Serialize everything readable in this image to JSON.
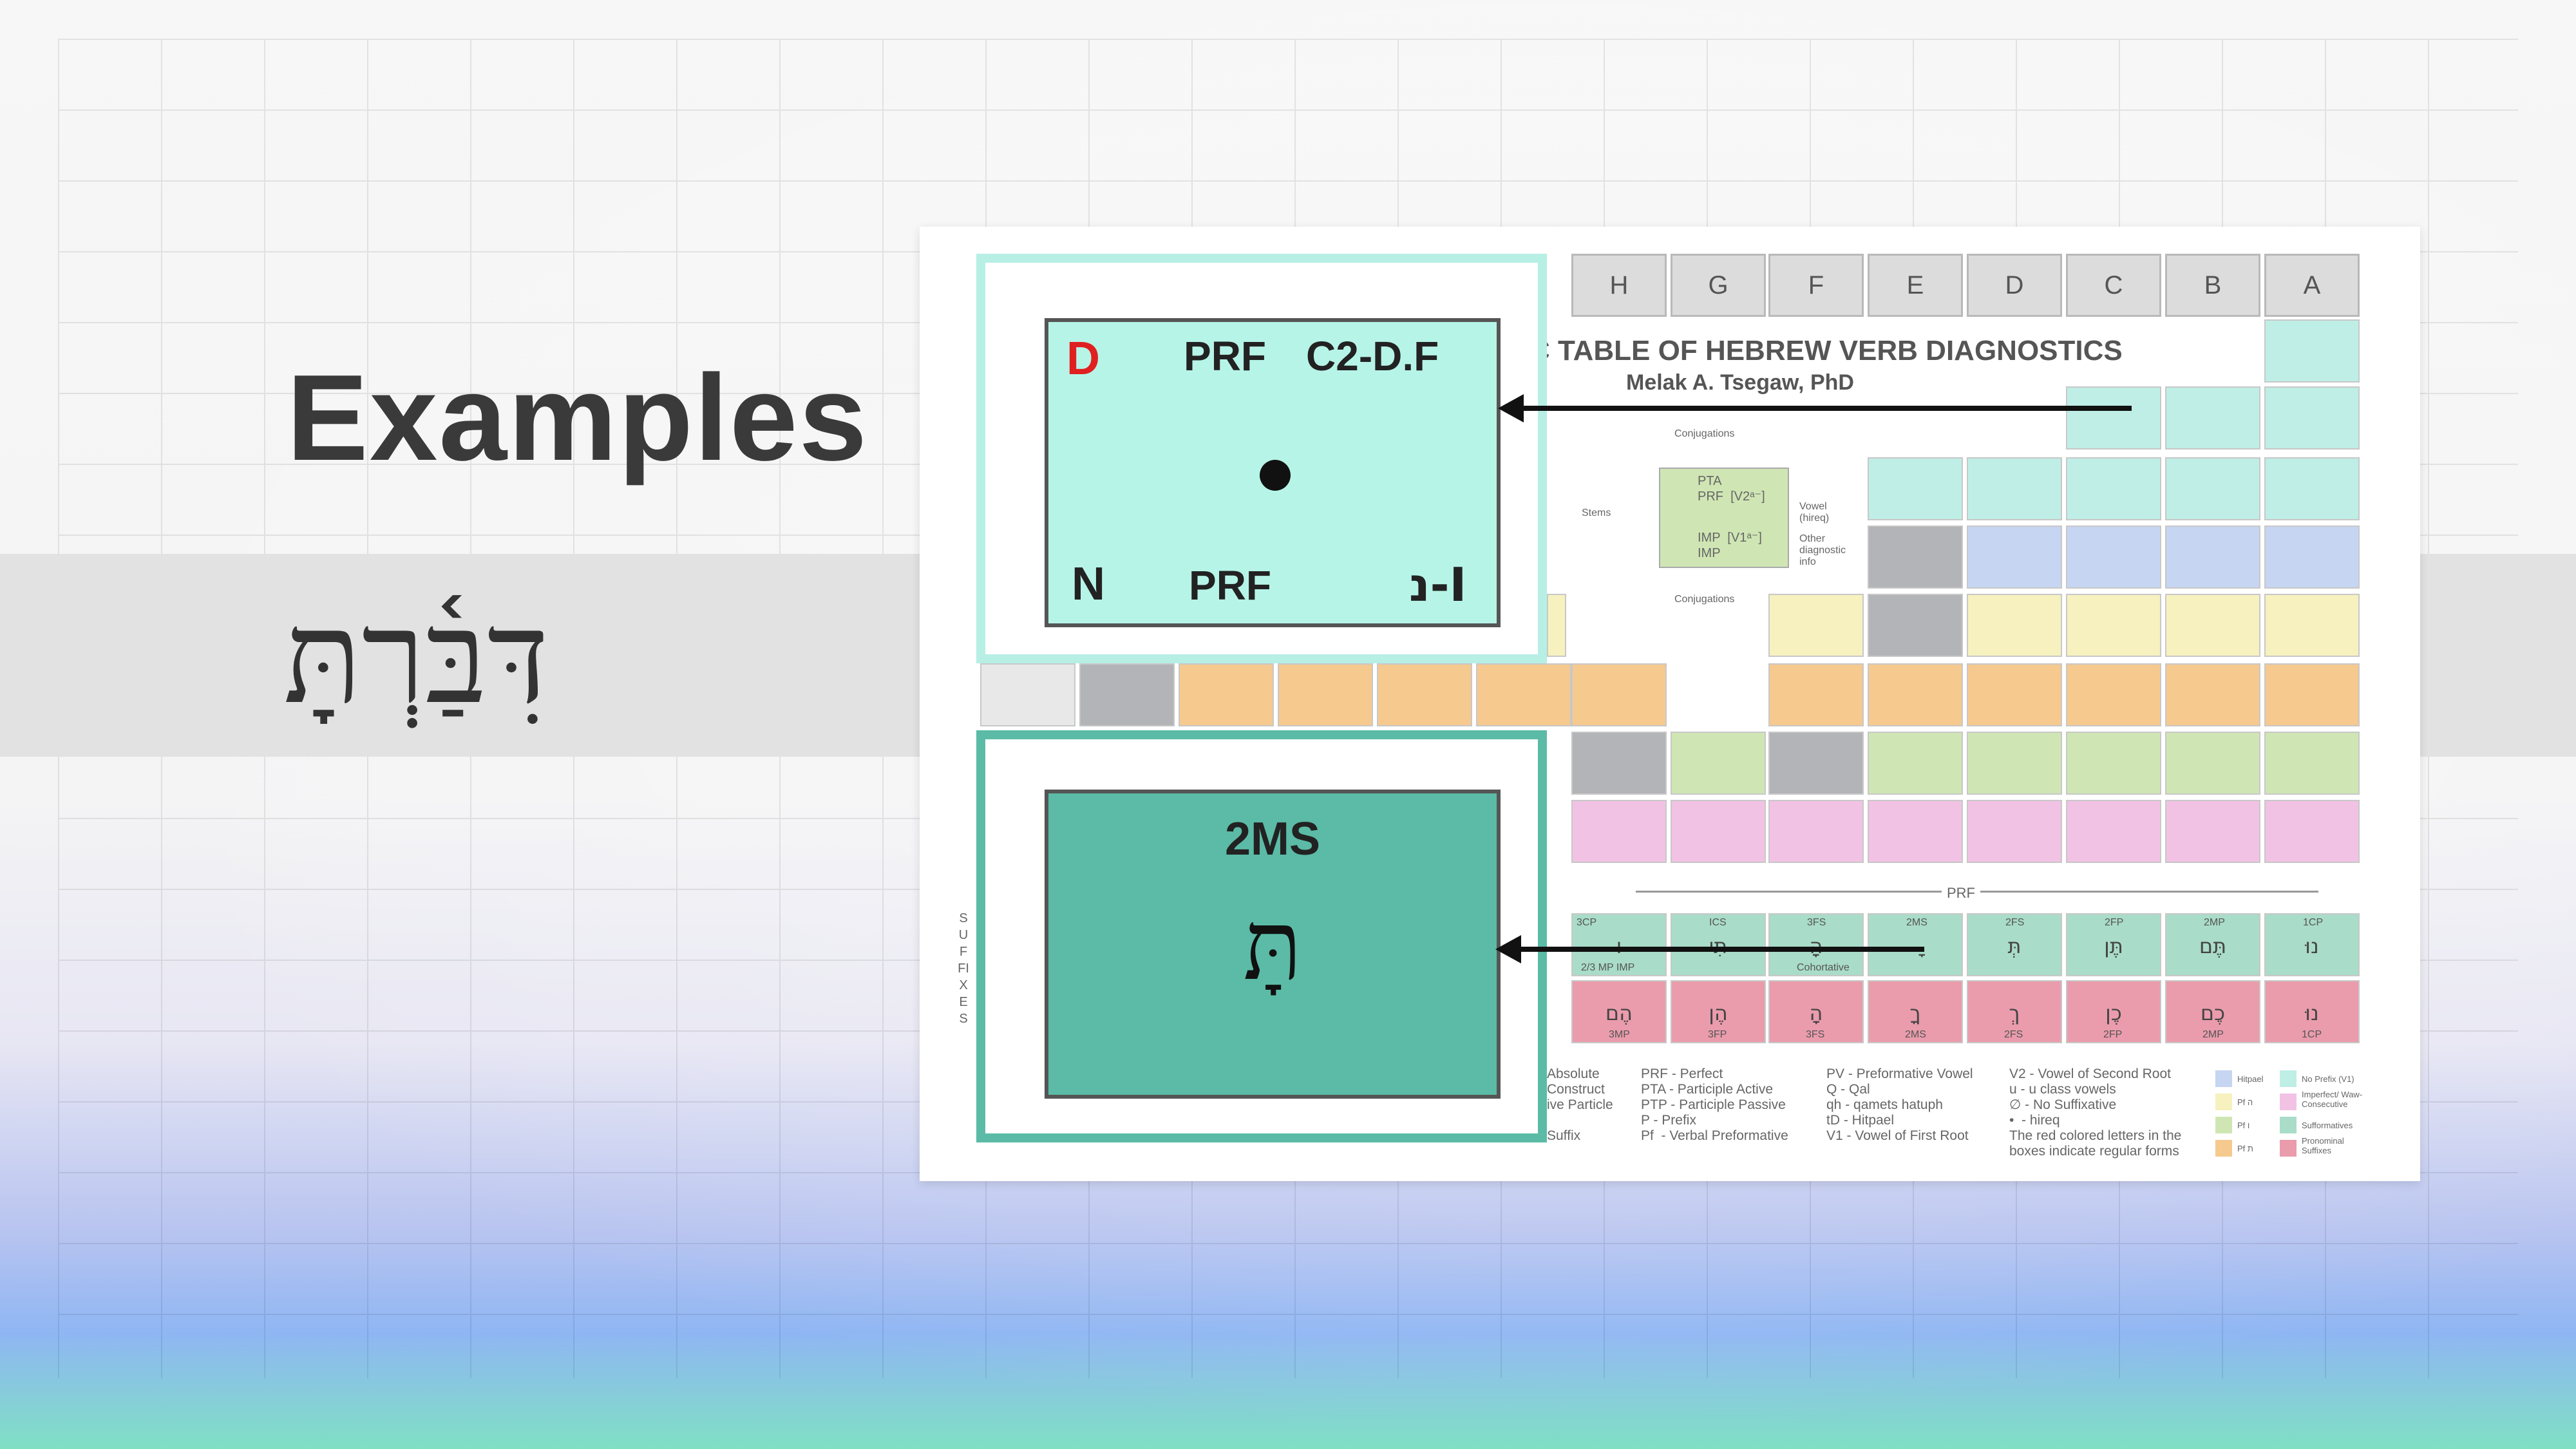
{
  "slide": {
    "title": "Examples",
    "hebrew_word": "דִּבַּ֫רְתָּ"
  },
  "poster": {
    "column_headers": [
      "H",
      "G",
      "F",
      "E",
      "D",
      "C",
      "B",
      "A"
    ],
    "title": "C TABLE OF HEBREW VERB DIAGNOSTICS",
    "author": "Melak A. Tsegaw, PhD",
    "diagram": {
      "top_label": "Conjugations",
      "bottom_label": "Conjugations",
      "stems_label": "Stems",
      "vowel_label": "Vowel\n(hireq)",
      "other_label": "Other\ndiagnostic\ninfo",
      "line1": "PTA",
      "line2": "PRF  [V2ᵃ⁻]",
      "line3": "IMP  [V1ᵃ⁻]",
      "line4": "IMP"
    },
    "prf_bar_label": "PRF",
    "suffixes_vertical": "SUFFIXES",
    "suffix_row_top": [
      {
        "code": "3CP",
        "glyph": "ּו"
      },
      {
        "code": "ICS",
        "glyph": "תִּי"
      },
      {
        "code": "3FS",
        "glyph": "ָה"
      },
      {
        "code": "2MS",
        "glyph": "ָּ"
      },
      {
        "code": "2FS",
        "glyph": "תְּ"
      },
      {
        "code": "2FP",
        "glyph": "תֶּן"
      },
      {
        "code": "2MP",
        "glyph": "תֶּם"
      },
      {
        "code": "1CP",
        "glyph": "נוּ"
      }
    ],
    "suffix_row_bottom": [
      {
        "code": "3MP",
        "glyph": "הֶם"
      },
      {
        "code": "3FP",
        "glyph": "הֶן"
      },
      {
        "code": "3FS",
        "glyph": "הָ"
      },
      {
        "code": "2MS",
        "glyph": "ךָ"
      },
      {
        "code": "2FS",
        "glyph": "ךְ"
      },
      {
        "code": "2FP",
        "glyph": "כֶן"
      },
      {
        "code": "2MP",
        "glyph": "כֶם"
      },
      {
        "code": "1CP",
        "glyph": "נוּ"
      }
    ],
    "cohortative_label": "Cohortative",
    "imp_label": "2/3 MP IMP",
    "legend_col1": "Absolute\nConstruct\nive Particle\n\nSuffix",
    "legend_col2": "PRF - Perfect\nPTA - Participle Active\nPTP - Participle Passive\nP - Prefix\nPf  - Verbal Preformative",
    "legend_col3": "PV - Preformative Vowel\nQ - Qal\nqh - qamets hatuph\ntD - Hitpael\nV1 - Vowel of First Root",
    "legend_col4": "V2 - Vowel of Second Root\nu - u class vowels\n∅ - No Suffixative\n•  - hireq\nThe red colored letters in the\nboxes indicate regular forms",
    "legend_swatches": [
      {
        "label": "Hitpael",
        "color": "#c5d5f2"
      },
      {
        "label": "Pf ה",
        "color": "#f6f1bf"
      },
      {
        "label": "Pf ו",
        "color": "#cfe6b4"
      },
      {
        "label": "Pf ת",
        "color": "#f6c98f"
      },
      {
        "label": "No Prefix (V1)",
        "color": "#bfeee6"
      },
      {
        "label": "Imperfect/ Waw-Consecutive",
        "color": "#f1c2e4"
      },
      {
        "label": "Sufformatives",
        "color": "#a9dcc9"
      },
      {
        "label": "Pronominal Suffixes",
        "color": "#ea9cac"
      }
    ]
  },
  "zoom_stem": {
    "stem_letter": "D",
    "conjugation": "PRF",
    "diagnostic": "C2-D.F",
    "bottom_stem": "N",
    "bottom_conj": "PRF",
    "root_class": "נ-I",
    "stem_color": "#e02020"
  },
  "zoom_suffix": {
    "label": "2MS",
    "glyph": "תָּ"
  },
  "colors": {
    "accent_teal": "#5bbba6",
    "light_teal": "#b7f4e8",
    "arrow": "#111111"
  }
}
